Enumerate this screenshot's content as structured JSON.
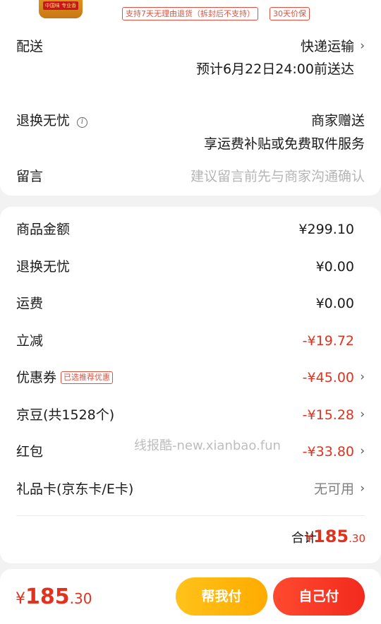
{
  "product": {
    "bottle_label": "中国味 专业香",
    "tags": [
      "支持7天无理由退货（拆封后不支持）",
      "30天价保"
    ]
  },
  "delivery": {
    "label": "配送",
    "method": "快递运输",
    "eta": "预计6月22日24:00前送达"
  },
  "returns": {
    "label": "退换无忧",
    "value": "商家赠送",
    "desc": "享运费补贴或免费取件服务"
  },
  "message": {
    "label": "留言",
    "placeholder": "建议留言前先与商家沟通确认"
  },
  "summary": {
    "rows": [
      {
        "label": "商品金额",
        "value": "¥299.10"
      },
      {
        "label": "退换无忧",
        "value": "¥0.00"
      },
      {
        "label": "运费",
        "value": "¥0.00"
      },
      {
        "label": "立减",
        "value": "-¥19.72"
      },
      {
        "label": "优惠券",
        "badge": "已选推荐优惠",
        "value": "-¥45.00"
      },
      {
        "label": "京豆(共1528个)",
        "value": "-¥15.28"
      },
      {
        "label": "红包",
        "value": "-¥33.80"
      },
      {
        "label": "礼品卡(京东卡/E卡)",
        "value": "无可用"
      }
    ],
    "total_label": "合计:",
    "total": {
      "symbol": "¥",
      "integer": "185",
      "decimal": ".30"
    }
  },
  "watermark": "线报酷-new.xianbao.fun",
  "pay_bar": {
    "amount": {
      "symbol": "¥",
      "integer": "185",
      "decimal": ".30"
    },
    "help_button": "帮我付",
    "self_button": "自己付"
  },
  "colors": {
    "accent_red": "#e2321e",
    "help_yellow": "#ffb300",
    "pay_red": "#f22a1e"
  },
  "icons": {
    "chevron": "chevron-right-icon",
    "info": "info-icon"
  }
}
